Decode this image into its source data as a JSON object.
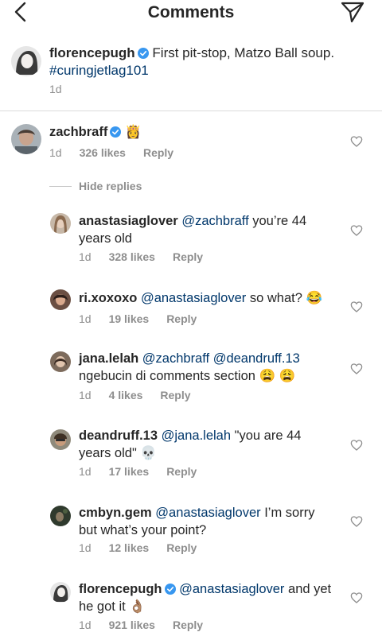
{
  "header": {
    "title": "Comments"
  },
  "caption": {
    "username": "florencepugh",
    "text": "First pit-stop, Matzo Ball soup.",
    "hashtag": "#curingjetlag101",
    "time": "1d"
  },
  "top_comment": {
    "username": "zachbraff",
    "emoji": "👸",
    "time": "1d",
    "likes": "326 likes",
    "reply_label": "Reply"
  },
  "hide_replies_label": "Hide replies",
  "replies": [
    {
      "username": "anastasiaglover",
      "mention": "@zachbraff",
      "text_line1": " you’re 44",
      "text_line2": "years old",
      "time": "1d",
      "likes": "328 likes",
      "reply_label": "Reply"
    },
    {
      "username": "ri.xoxoxo",
      "mention": "@anastasiaglover",
      "text_line1": " so what? 😂",
      "time": "1d",
      "likes": "19 likes",
      "reply_label": "Reply"
    },
    {
      "username": "jana.lelah",
      "mention": "@zachbraff @deandruff.13",
      "text_line2": "ngebucin di comments section 😩 😩",
      "time": "1d",
      "likes": "4 likes",
      "reply_label": "Reply"
    },
    {
      "username": "deandruff.13",
      "mention": "@jana.lelah",
      "text_line1": " \"you are 44",
      "text_line2": "years old\" 💀",
      "time": "1d",
      "likes": "17 likes",
      "reply_label": "Reply"
    },
    {
      "username": "cmbyn.gem",
      "mention": "@anastasiaglover",
      "text_line1": " I’m sorry",
      "text_line2": "but what’s your point?",
      "time": "1d",
      "likes": "12 likes",
      "reply_label": "Reply"
    },
    {
      "username": "florencepugh",
      "mention": "@anastasiaglover",
      "text_line1": " and yet",
      "text_line2": "he  got it 👌🏽",
      "time": "1d",
      "likes": "921 likes",
      "reply_label": "Reply"
    }
  ],
  "icons": {
    "back": "chevron-left-icon",
    "send": "paper-plane-icon",
    "like": "heart-outline-icon",
    "verified": "verified-badge-icon"
  },
  "colors": {
    "text": "#262626",
    "secondary": "#8e8e8e",
    "link": "#00376b",
    "verified": "#3897f0",
    "divider": "#dbdbdb"
  }
}
